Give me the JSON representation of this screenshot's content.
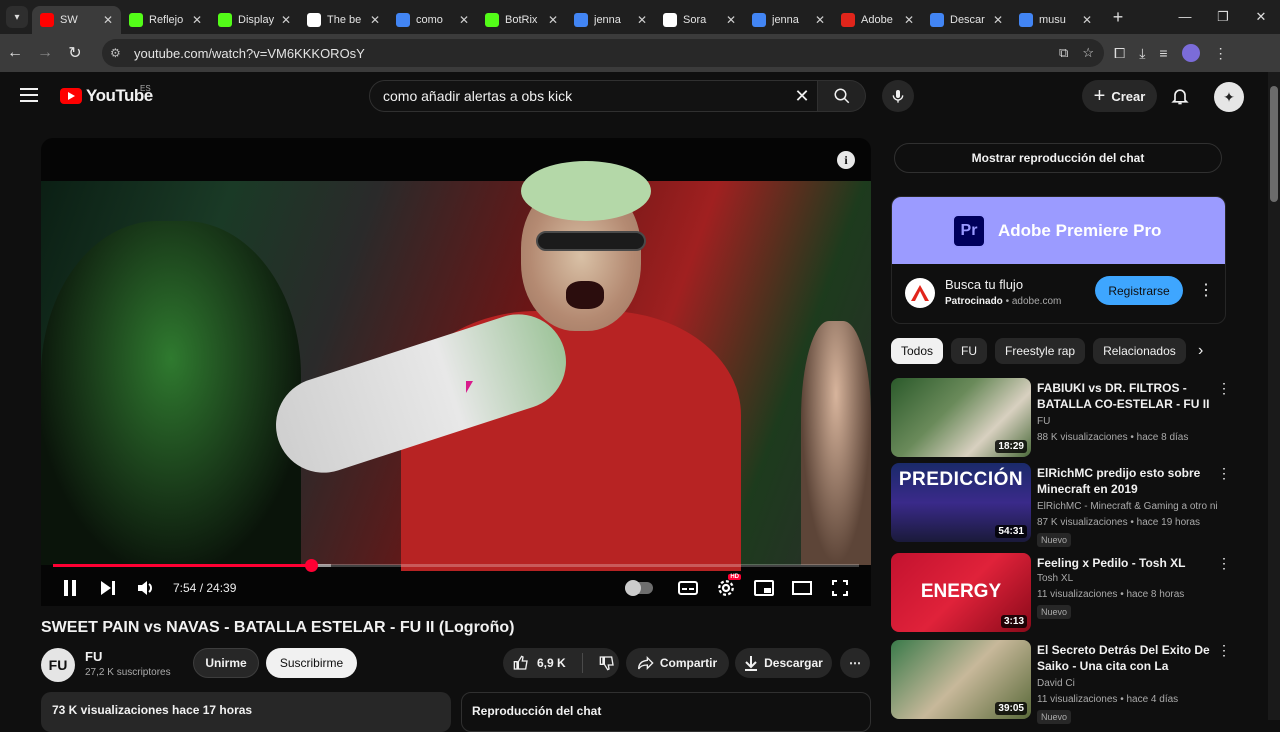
{
  "browser": {
    "tabs": [
      {
        "title": "SW",
        "favicon_color": "#ff0000",
        "active": true
      },
      {
        "title": "Reflejo",
        "favicon_color": "#53fc18"
      },
      {
        "title": "Display",
        "favicon_color": "#53fc18"
      },
      {
        "title": "The be",
        "favicon_color": "#ffffff"
      },
      {
        "title": "como",
        "favicon_color": "#4285f4"
      },
      {
        "title": "BotRix",
        "favicon_color": "#53fc18"
      },
      {
        "title": "jenna",
        "favicon_color": "#4285f4"
      },
      {
        "title": "Sora",
        "favicon_color": "#ffffff"
      },
      {
        "title": "jenna",
        "favicon_color": "#4285f4"
      },
      {
        "title": "Adobe",
        "favicon_color": "#e1251b"
      },
      {
        "title": "Descar",
        "favicon_color": "#4285f4"
      },
      {
        "title": "musu",
        "favicon_color": "#4285f4"
      }
    ],
    "url": "youtube.com/watch?v=VM6KKKOROsY"
  },
  "youtube": {
    "logo_text": "YouTube",
    "country_code": "ES",
    "search_query": "como añadir alertas a obs kick",
    "create_label": "Crear"
  },
  "player": {
    "current_time": "7:54",
    "duration": "24:39",
    "time_display": "7:54 / 24:39",
    "progress_fraction": 0.32,
    "buffered_fraction": 0.345
  },
  "video": {
    "title": "SWEET PAIN vs NAVAS - BATALLA ESTELAR - FU II (Logroño)",
    "channel_name": "FU",
    "channel_avatar_text": "FU",
    "subscribers": "27,2 K suscriptores",
    "join_label": "Unirme",
    "subscribe_label": "Suscribirme",
    "likes": "6,9 K",
    "share_label": "Compartir",
    "download_label": "Descargar",
    "description_stats": "73 K visualizaciones  hace 17 horas",
    "chat_replay_label": "Reproducción del chat"
  },
  "sidebar": {
    "show_chat_label": "Mostrar reproducción del chat",
    "ad": {
      "brand_logo_text": "Pr",
      "brand": "Adobe Premiere Pro",
      "headline": "Busca tu flujo",
      "sponsored": "Patrocinado",
      "domain": "adobe.com",
      "cta": "Registrarse"
    },
    "chips": [
      "Todos",
      "FU",
      "Freestyle rap",
      "Relacionados"
    ],
    "recommendations": [
      {
        "title": "FABIUKI vs DR. FILTROS - BATALLA CO-ESTELAR - FU II ...",
        "channel": "FU",
        "meta": "88 K visualizaciones • hace 8 días",
        "duration": "18:29",
        "badge": "",
        "thumb_text": ""
      },
      {
        "title": "ElRichMC predijo esto sobre Minecraft en 2019",
        "channel": "ElRichMC - Minecraft & Gaming a otro ni...",
        "meta": "87 K visualizaciones • hace 19 horas",
        "duration": "54:31",
        "badge": "Nuevo",
        "thumb_text": "PREDICCIÓN"
      },
      {
        "title": "Feeling x Pedilo - Tosh XL",
        "channel": "Tosh XL",
        "meta": "11 visualizaciones • hace 8 horas",
        "duration": "3:13",
        "badge": "Nuevo",
        "thumb_text": "ENERGY"
      },
      {
        "title": "El Secreto Detrás Del Exito De Saiko  - Una cita con La Mano...",
        "channel": "David Ci",
        "meta": "11 visualizaciones • hace 4 días",
        "duration": "39:05",
        "badge": "Nuevo",
        "thumb_text": ""
      }
    ]
  }
}
